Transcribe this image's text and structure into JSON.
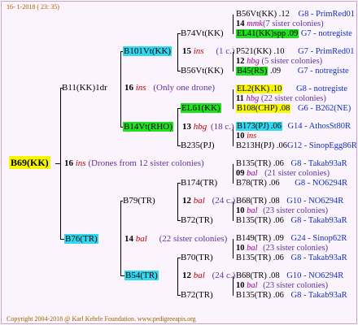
{
  "header": {
    "date": "16-  1-2018 ( 23: 35)"
  },
  "footer": {
    "copyright": "Copyright 2004-2018 @ Karl Kehrle Foundation.   www.pedigreeapis.org"
  },
  "root": {
    "name": "B69(KK)",
    "num": "16",
    "ins": "ins",
    "note": "(Drones from 12 sister colonies)"
  },
  "upper": {
    "name": "B11(KK)1dr",
    "num": "16",
    "ins": "ins",
    "note": "(Only one drone)",
    "a": {
      "name": "B101Vt(KK)",
      "num": "15",
      "ins": "ins",
      "note": "(1 c.)",
      "b1": {
        "name": "B74Vt(KK)"
      },
      "b2": {
        "name": "B56Vt(KK)"
      }
    },
    "c": {
      "name": "B14Vt(RHO)",
      "num": "13",
      "ins": "hbg",
      "note": "(18 c.)",
      "d1": {
        "name": "EL61(KK)"
      },
      "d2": {
        "name": "B235(PJ)"
      }
    }
  },
  "lower": {
    "name": "B76(TR)",
    "num": "14",
    "ins": "bal",
    "note": "(22 sister colonies)",
    "e": {
      "name": "B79(TR)",
      "num": "12",
      "ins": "bal",
      "note": "(24 c.)",
      "f1": {
        "name": "B174(TR)"
      },
      "f2": {
        "name": "B72(TR)"
      }
    },
    "g": {
      "name": "B54(TR)",
      "num": "12",
      "ins": "bal",
      "note": "(24 c.)",
      "h1": {
        "name": "B70(TR)"
      },
      "h2": {
        "name": "B72(TR)"
      }
    }
  },
  "right": [
    {
      "name": "B56Vt(KK)",
      "num": ".12",
      "origin": "G8 - PrimRed01"
    },
    {
      "num": "14",
      "ins": "mmk",
      "note": "(7 sister colonies)"
    },
    {
      "name": "EL41(KK)spp",
      "num": ".09",
      "origin": "G7 - notregiste"
    },
    {
      "name": "P521(KK)",
      "num": ".10",
      "origin": "G7 - PrimRed01"
    },
    {
      "num": "12",
      "ins": "hbg",
      "note": "(5 sister colonies)"
    },
    {
      "name": "B45(RS)",
      "num": ".09",
      "origin": "G7 - notregiste"
    },
    {
      "name": "EL2(KK)",
      "num": ".10",
      "origin": "G8 - notregiste"
    },
    {
      "num": "11",
      "ins": "hbg",
      "note": "(22 sister colonies)"
    },
    {
      "name": "B108(CHP)",
      "num": ".08",
      "origin": "G6 - B262(NE)"
    },
    {
      "name": "B173(PJ)",
      "num": ".06",
      "origin": "G14 - AthosSt80R"
    },
    {
      "num": "10",
      "ins": "ins",
      "note": ""
    },
    {
      "name": "B213H(PJ)",
      "num": ".06",
      "origin": "G12 - SinopEgg86R"
    },
    {
      "name": "B135(TR)",
      "num": ".06",
      "origin": "G8 - Takab93aR"
    },
    {
      "num": "09",
      "ins": "bal",
      "note": "(21 sister colonies)"
    },
    {
      "name": "B78(TR)",
      "num": ".06",
      "origin": "G8 - NO6294R"
    },
    {
      "name": "B68(TR)",
      "num": ".08",
      "origin": "G10 - NO6294R"
    },
    {
      "num": "10",
      "ins": "bal",
      "note": "(23 sister colonies)"
    },
    {
      "name": "B135(TR)",
      "num": ".06",
      "origin": "G8 - Takab93aR"
    },
    {
      "name": "B149(TR)",
      "num": ".09",
      "origin": "G24 - Sinop62R"
    },
    {
      "num": "10",
      "ins": "bal",
      "note": "(23 sister colonies)"
    },
    {
      "name": "B135(TR)",
      "num": ".06",
      "origin": "G8 - Takab93aR"
    },
    {
      "name": "B68(TR)",
      "num": ".08",
      "origin": "G10 - NO6294R"
    },
    {
      "num": "10",
      "ins": "bal",
      "note": "(23 sister colonies)"
    },
    {
      "name": "B135(TR)",
      "num": ".06",
      "origin": "G8 - Takab93aR"
    }
  ],
  "colors": {
    "cyan": "#30d8f0",
    "green": "#20e020",
    "yellow": "#f8f800",
    "ins_red": "#c00000",
    "note_purple": "#6030a0",
    "origin_blue": "#1030c0"
  }
}
